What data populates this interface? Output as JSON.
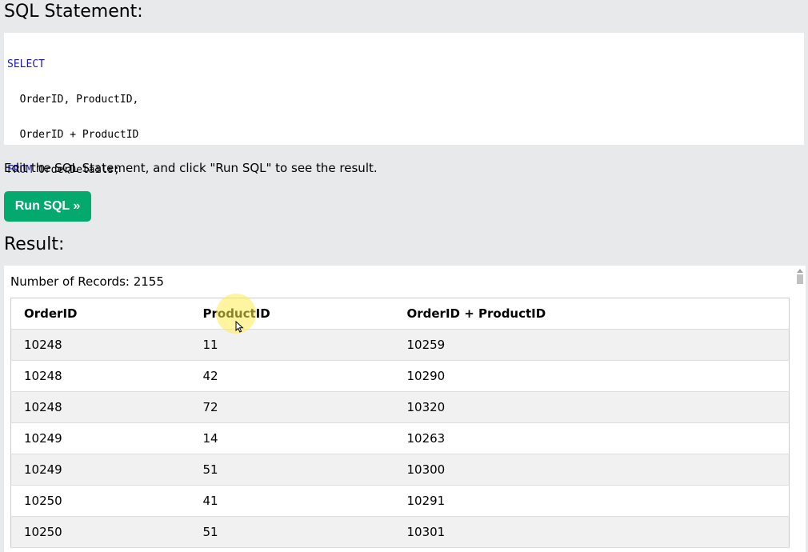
{
  "sql_section": {
    "heading": "SQL Statement:",
    "lines": [
      {
        "keyword": "SELECT",
        "rest": ""
      },
      {
        "keyword": "",
        "rest": "  OrderID, ProductID,"
      },
      {
        "keyword": "",
        "rest": "  OrderID + ProductID"
      },
      {
        "keyword": "FROM",
        "rest": " OrderDetails;"
      }
    ]
  },
  "instruction": "Edit the SQL Statement, and click \"Run SQL\" to see the result.",
  "run_button_label": "Run SQL »",
  "result_section": {
    "heading": "Result:",
    "records_text": "Number of Records: 2155",
    "columns": [
      "OrderID",
      "ProductID",
      "OrderID + ProductID"
    ],
    "rows": [
      [
        "10248",
        "11",
        "10259"
      ],
      [
        "10248",
        "42",
        "10290"
      ],
      [
        "10248",
        "72",
        "10320"
      ],
      [
        "10249",
        "14",
        "10263"
      ],
      [
        "10249",
        "51",
        "10300"
      ],
      [
        "10250",
        "41",
        "10291"
      ],
      [
        "10250",
        "51",
        "10301"
      ]
    ]
  },
  "colors": {
    "button": "#04aa6d",
    "keyword": "#1a1aa6",
    "page_bg": "#e7e9eb",
    "row_stripe": "#f1f1f1"
  }
}
